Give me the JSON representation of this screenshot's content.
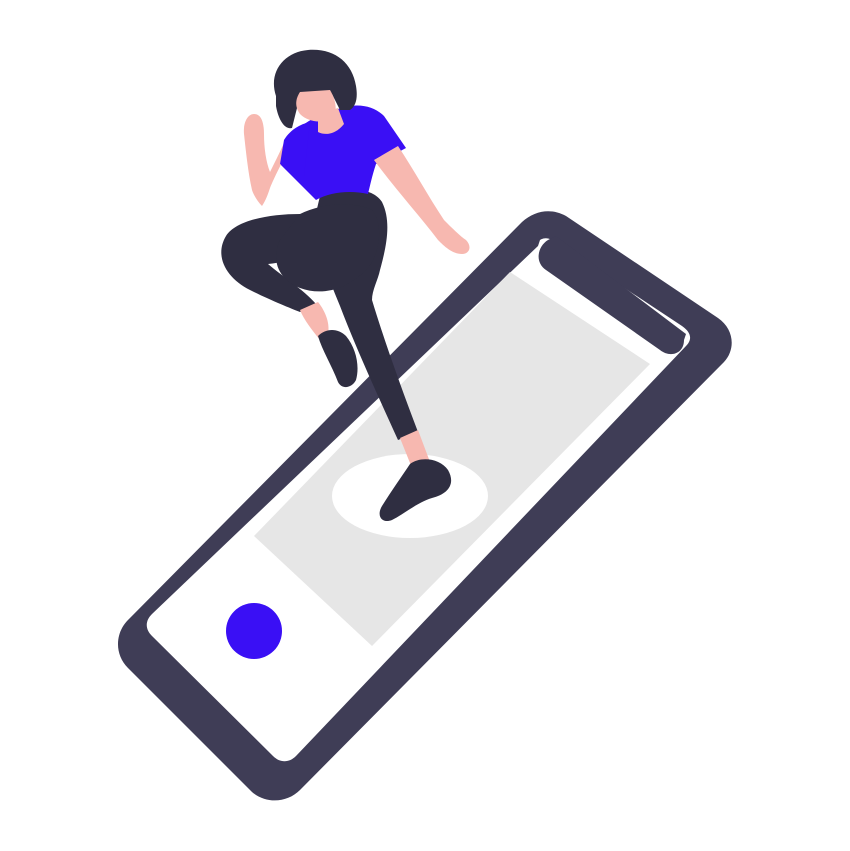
{
  "illustration": {
    "subject": "woman-stepping-on-smartphone",
    "colors": {
      "background": "#ffffff",
      "phone_frame": "#3f3d56",
      "phone_screen": "#ffffff",
      "screen_card": "#e6e6e6",
      "accent": "#3a0ff5",
      "skin": "#f7b8b0",
      "hair": "#2f2e41",
      "pants": "#2f2e41",
      "shoes": "#2f2e41",
      "shirt": "#3a0ff5",
      "spotlight": "#ffffff"
    }
  }
}
